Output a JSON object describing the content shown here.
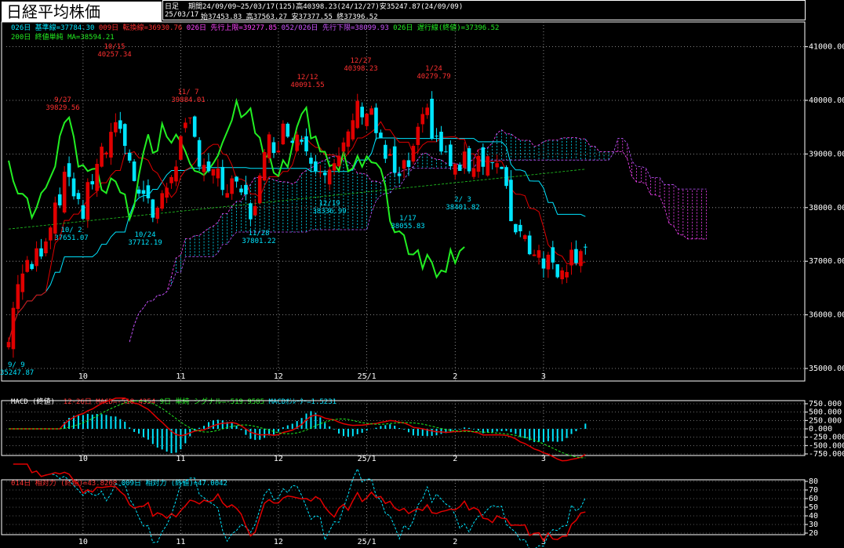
{
  "title": "日経平均株価",
  "header": {
    "period_type": "日足",
    "period_info": "期間24/09/09~25/03/17(125)高40398.23(24/12/27)安35247.87(24/09/09)",
    "date": "25/03/17",
    "ohlc": "始37453.83 高37563.27 安37377.55 終37396.52"
  },
  "colors": {
    "background": "#000000",
    "up_candle": "#e00000",
    "down_candle": "#00e5ff",
    "base_line": "#00e5ff",
    "conversion_line": "#e00000",
    "span1": "#ff44ff",
    "span2": "#bb55ff",
    "lagging": "#22ee22",
    "ma200": "#22cc22",
    "grid": "#ffffff"
  },
  "legend_main": [
    {
      "text": "026日 基準線=37784.30",
      "color": "#00e5ff"
    },
    {
      "text": "009日 転換線=36930.76",
      "color": "#ff3030"
    },
    {
      "text": "026日 先行上限=39277.85",
      "color": "#ff44ff"
    },
    {
      "text": "052/026日 先行下限=38099.93",
      "color": "#cc55ff"
    },
    {
      "text": "026日 遅行線(終値)=37396.52",
      "color": "#22ee22"
    }
  ],
  "legend_main2": {
    "text": "200日 終値単純 MA=38594.21",
    "color": "#22ee22"
  },
  "legend_macd": [
    {
      "text": "MACD (終値)",
      "color": "#ffffff"
    },
    {
      "text": "12-26日 MACD=-518.4354",
      "color": "#ff3030"
    },
    {
      "text": "9日 単純 シグナル=-519.9585",
      "color": "#22ee22"
    },
    {
      "text": "MACDｵｼﾚｰﾀｰ=1.5231",
      "color": "#00e5ff"
    }
  ],
  "legend_rsi": [
    {
      "text": "014日 相対力 (終値)=43.8208",
      "color": "#ff3030"
    },
    {
      "text": "009日 相対力 (終値)=47.0042",
      "color": "#00e5ff"
    }
  ],
  "x_ticks": [
    "10",
    "11",
    "12",
    "25/1",
    "2",
    "3"
  ],
  "main_axis_labels": [
    "41000.00",
    "40000.00",
    "39000.00",
    "38000.00",
    "37000.00",
    "36000.00",
    "35000.00"
  ],
  "macd_axis_labels": [
    "750.000",
    "500.000",
    "250.000",
    "0.000",
    "-250.000",
    "-500.000",
    "-750.000"
  ],
  "rsi_axis_labels": [
    "80",
    "70",
    "60",
    "50",
    "40",
    "30",
    "20"
  ],
  "annotations": [
    {
      "date": "9/27",
      "value": "39829.56"
    },
    {
      "date": "10/15",
      "value": "40257.34"
    },
    {
      "date": "11/ 7",
      "value": "39884.01"
    },
    {
      "date": "12/12",
      "value": "40091.55"
    },
    {
      "date": "12/27",
      "value": "40398.23"
    },
    {
      "date": "1/24",
      "value": "40279.79"
    },
    {
      "date": "10/ 2",
      "value": "37651.07"
    },
    {
      "date": "10/24",
      "value": "37712.19"
    },
    {
      "date": "11/28",
      "value": "37801.22"
    },
    {
      "date": "12/19",
      "value": "38336.99"
    },
    {
      "date": "1/17",
      "value": "38055.83"
    },
    {
      "date": "2/ 3",
      "value": "38401.82"
    },
    {
      "date": "9/ 9",
      "value": "35247.87"
    }
  ],
  "chart_data": [
    {
      "type": "candlestick",
      "title": "日経平均株価",
      "y_range": [
        35000,
        41200
      ],
      "x_ticks": [
        "10",
        "11",
        "12",
        "25/1",
        "2",
        "3"
      ],
      "series": [
        {
          "name": "基準線",
          "last": 37784.3
        },
        {
          "name": "転換線",
          "last": 36930.76
        },
        {
          "name": "先行上限",
          "last": 39277.85
        },
        {
          "name": "先行下限",
          "last": 38099.93
        },
        {
          "name": "遅行線(終値)",
          "last": 37396.52
        },
        {
          "name": "終値単純 MA",
          "last": 38594.21
        }
      ],
      "ohlc_last": {
        "date": "25/03/17",
        "open": 37453.83,
        "high": 37563.27,
        "low": 37377.55,
        "close": 37396.52
      },
      "period_high": {
        "date": "24/12/27",
        "value": 40398.23
      },
      "period_low": {
        "date": "24/09/09",
        "value": 35247.87
      },
      "peaks": [
        {
          "label": "9/27",
          "value": 39829.56
        },
        {
          "label": "10/15",
          "value": 40257.34
        },
        {
          "label": "11/ 7",
          "value": 39884.01
        },
        {
          "label": "12/12",
          "value": 40091.55
        },
        {
          "label": "12/27",
          "value": 40398.23
        },
        {
          "label": "1/24",
          "value": 40279.79
        }
      ],
      "troughs": [
        {
          "label": "10/ 2",
          "value": 37651.07
        },
        {
          "label": "10/24",
          "value": 37712.19
        },
        {
          "label": "11/28",
          "value": 37801.22
        },
        {
          "label": "12/19",
          "value": 38336.99
        },
        {
          "label": "1/17",
          "value": 38055.83
        },
        {
          "label": "2/ 3",
          "value": 38401.82
        }
      ],
      "grid": true
    },
    {
      "type": "line",
      "title": "MACD (終値)",
      "y_range": [
        -750,
        750
      ],
      "series": [
        {
          "name": "MACD",
          "last": -518.4354
        },
        {
          "name": "シグナル",
          "last": -519.9585
        },
        {
          "name": "MACDｵｼﾚｰﾀｰ",
          "last": 1.5231
        }
      ]
    },
    {
      "type": "line",
      "title": "相対力",
      "y_range": [
        20,
        80
      ],
      "series": [
        {
          "name": "相対力 014日",
          "last": 43.8208
        },
        {
          "name": "相対力 009日",
          "last": 47.0042
        }
      ]
    }
  ]
}
